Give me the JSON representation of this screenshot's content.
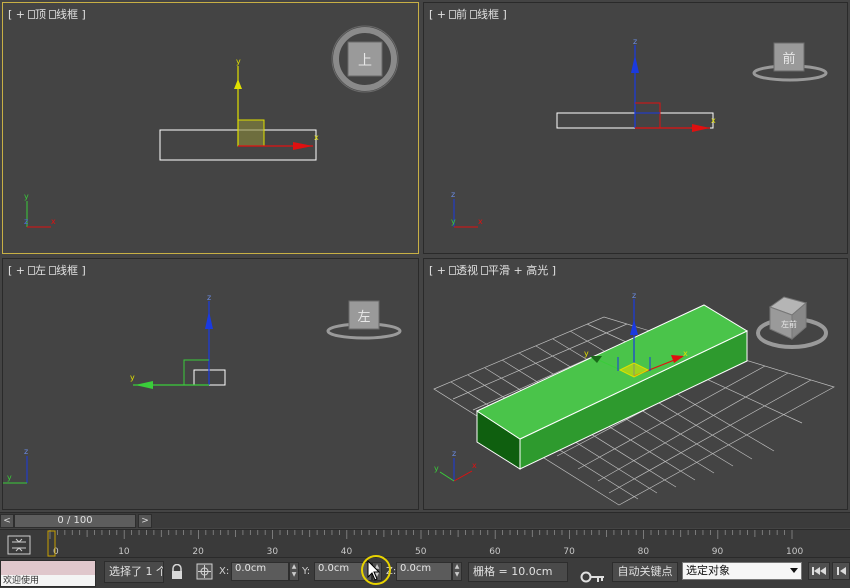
{
  "viewports": {
    "top": {
      "label_parts": [
        "[",
        "+",
        "顶",
        "线框",
        "]"
      ],
      "cube_label": "上",
      "active": true
    },
    "front": {
      "label_parts": [
        "[",
        "+",
        "前",
        "线框",
        "]"
      ],
      "cube_label": "前"
    },
    "left": {
      "label_parts": [
        "[",
        "+",
        "左",
        "线框",
        "]"
      ],
      "cube_label": "左"
    },
    "persp": {
      "label_parts": [
        "[",
        "+",
        "透视",
        "平滑",
        "+",
        "高光",
        "]"
      ],
      "cube_label": "左前"
    }
  },
  "axis_labels": {
    "x": "x",
    "y": "y",
    "z": "z"
  },
  "colors": {
    "axis_x": "#e01010",
    "axis_y": "#e0e000",
    "axis_z": "#1a3ae0",
    "box_green": "#3cb83c",
    "active_border": "#c8b045"
  },
  "time_slider": {
    "label": "0 / 100",
    "prev": "<",
    "next": ">"
  },
  "track_ticks": [
    "0",
    "10",
    "20",
    "30",
    "40",
    "50",
    "60",
    "70",
    "80",
    "90",
    "100"
  ],
  "status": {
    "selection": "选择了 1 个",
    "x_label": "X:",
    "x_value": "0.0cm",
    "y_label": "Y:",
    "y_value": "0.0cm",
    "z_label": "Z:",
    "z_value": "0.0cm",
    "grid": "栅格 = 10.0cm",
    "auto_key": "自动关键点",
    "key_mode": "选定对象",
    "maxscript_lower": "欢迎使用"
  },
  "icons": {
    "lock": "lock-icon",
    "transform": "absolute-mode-icon",
    "key": "set-key-icon",
    "go_start": "go-to-start-icon",
    "prev_frame": "previous-frame-icon"
  }
}
